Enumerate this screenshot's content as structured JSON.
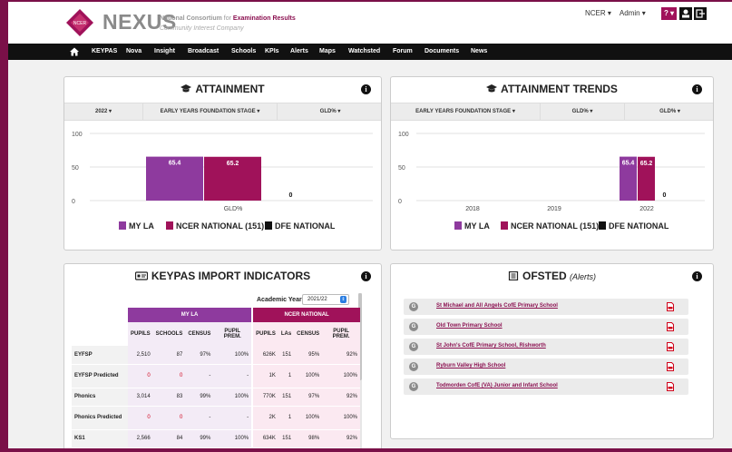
{
  "header": {
    "brand": "NEXUS",
    "logo_text": "NCER",
    "org_line1_a": "National Consortium",
    "org_line1_b": "for",
    "org_line1_c": "Examination Results",
    "org_line2": "Community Interest Company",
    "account_org": "NCER ▾",
    "account_user": "Admin ▾",
    "help_label": "? ▾",
    "user_icon": "user-icon",
    "logout_icon": "logout-icon",
    "colors": {
      "accent": "#8b1050",
      "help": "#a0125a"
    }
  },
  "nav": {
    "home_icon": "home-icon",
    "items": [
      "KEYPAS",
      "Nova",
      "Insight",
      "Broadcast",
      "Schools",
      "KPIs",
      "Alerts",
      "Maps",
      "Watchsted",
      "Forum",
      "Documents",
      "News"
    ]
  },
  "attainment": {
    "title": "ATTAINMENT",
    "filters": [
      "2022 ▾",
      "EARLY YEARS FOUNDATION STAGE ▾",
      "GLD% ▾"
    ],
    "chart_data": {
      "type": "bar",
      "categories": [
        "GLD%"
      ],
      "series": [
        {
          "name": "MY LA",
          "values": [
            65.4
          ],
          "color": "#8e3a9e"
        },
        {
          "name": "NCER NATIONAL (151)",
          "values": [
            65.2
          ],
          "color": "#a0125a"
        },
        {
          "name": "DFE NATIONAL",
          "values": [
            0
          ],
          "color": "#111111"
        }
      ],
      "ylim": [
        0,
        100
      ],
      "yticks": [
        "100",
        "50",
        "0"
      ],
      "data_labels": [
        "65.4",
        "65.2",
        "0"
      ],
      "grid": true,
      "legend": "bottom"
    }
  },
  "trends": {
    "title": "ATTAINMENT TRENDS",
    "filters": [
      "EARLY YEARS FOUNDATION STAGE ▾",
      "GLD% ▾",
      "GLD% ▾"
    ],
    "chart_data": {
      "type": "bar",
      "categories": [
        "2018",
        "2019",
        "2022"
      ],
      "series": [
        {
          "name": "MY LA",
          "values": [
            null,
            null,
            65.4
          ],
          "color": "#8e3a9e"
        },
        {
          "name": "NCER NATIONAL (151)",
          "values": [
            null,
            null,
            65.2
          ],
          "color": "#a0125a"
        },
        {
          "name": "DFE NATIONAL",
          "values": [
            null,
            null,
            0
          ],
          "color": "#111111"
        }
      ],
      "ylim": [
        0,
        100
      ],
      "yticks": [
        "100",
        "50",
        "0"
      ],
      "data_labels": [
        "65.4",
        "65.2",
        "0"
      ],
      "grid": true,
      "legend": "bottom"
    }
  },
  "keypas": {
    "title": "KEYPAS IMPORT INDICATORS",
    "academic_year_label": "Academic Year:",
    "academic_year_value": "2021/22",
    "group_myla": "MY LA",
    "group_ncer": "NCER NATIONAL",
    "columns": [
      "PUPILS",
      "SCHOOLS",
      "CENSUS",
      "PUPIL PREM.",
      "PUPILS",
      "LAs",
      "CENSUS",
      "PUPIL PREM."
    ],
    "rows": [
      {
        "label": "EYFSP",
        "cells": [
          "2,510",
          "87",
          "97%",
          "100%",
          "626K",
          "151",
          "95%",
          "92%"
        ]
      },
      {
        "label": "EYFSP Predicted",
        "cells": [
          "0",
          "0",
          "-",
          "-",
          "1K",
          "1",
          "100%",
          "100%"
        ]
      },
      {
        "label": "Phonics",
        "cells": [
          "3,014",
          "83",
          "99%",
          "100%",
          "770K",
          "151",
          "97%",
          "92%"
        ]
      },
      {
        "label": "Phonics Predicted",
        "cells": [
          "0",
          "0",
          "-",
          "-",
          "2K",
          "1",
          "100%",
          "100%"
        ]
      },
      {
        "label": "KS1",
        "cells": [
          "2,566",
          "84",
          "99%",
          "100%",
          "634K",
          "151",
          "98%",
          "92%"
        ]
      }
    ],
    "colors": {
      "myla": "#8e3a9e",
      "ncer": "#a0125a"
    }
  },
  "ofsted": {
    "title": "OFSTED",
    "subtitle": "(Alerts)",
    "badge": "G",
    "schools": [
      "St Michael and All Angels CofE Primary School",
      "Old Town Primary School",
      "St John's CofE Primary School, Rishworth",
      "Ryburn Valley High School",
      "Todmorden CofE (VA) Junior and Infant School"
    ]
  }
}
